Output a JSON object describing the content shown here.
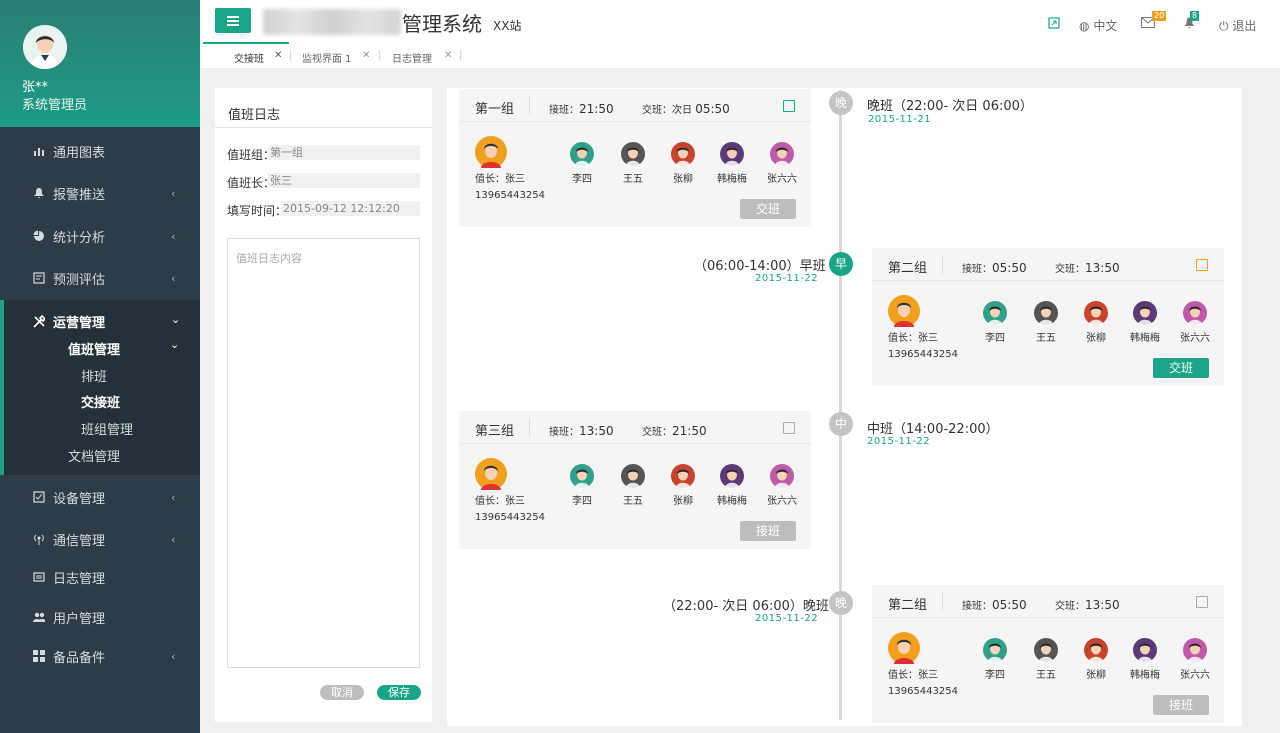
{
  "user": {
    "name": "张**",
    "role": "系统管理员"
  },
  "header": {
    "title": "管理系统",
    "subtitle": "XX站",
    "lang": "中文",
    "mail_count": "20",
    "bell_count": "8",
    "logout": "退出"
  },
  "tabs": [
    {
      "label": "交接班"
    },
    {
      "label": "监视界面 1"
    },
    {
      "label": "日志管理"
    }
  ],
  "sidebar": {
    "items": [
      {
        "label": "通用图表",
        "icon": "bar-chart-icon"
      },
      {
        "label": "报警推送",
        "icon": "bell-icon"
      },
      {
        "label": "统计分析",
        "icon": "pie-chart-icon"
      },
      {
        "label": "预测评估",
        "icon": "forecast-icon"
      },
      {
        "label": "运营管理",
        "icon": "tools-icon"
      },
      {
        "label": "设备管理",
        "icon": "device-icon"
      },
      {
        "label": "通信管理",
        "icon": "signal-icon"
      },
      {
        "label": "日志管理",
        "icon": "log-icon"
      },
      {
        "label": "用户管理",
        "icon": "users-icon"
      },
      {
        "label": "备品备件",
        "icon": "grid-icon"
      }
    ],
    "sub": {
      "duty": "值班管理",
      "schedule": "排班",
      "handover": "交接班",
      "groups": "班组管理",
      "docs": "文档管理"
    }
  },
  "log": {
    "title": "值班日志",
    "group_label": "值班组：",
    "group_value": "第一组",
    "leader_label": "值班长：",
    "leader_value": "张三",
    "time_label": "填写时间：",
    "time_value": "2015-09-12  12:12:20",
    "content_placeholder": "值班日志内容",
    "cancel": "取消",
    "save": "保存"
  },
  "timeline": [
    {
      "marker": "晚",
      "heading": "晚班（22:00- 次日 06:00）",
      "date": "2015-11-21"
    },
    {
      "marker": "早",
      "heading": "（06:00-14:00）早班",
      "date": "2015-11-22"
    },
    {
      "marker": "中",
      "heading": "中班（14:00-22:00）",
      "date": "2015-11-22"
    },
    {
      "marker": "晚",
      "heading": "（22:00- 次日 06:00）晚班",
      "date": "2015-11-22"
    }
  ],
  "cards": [
    {
      "group": "第一组",
      "on_label": "接班：",
      "on_time": "21:50",
      "off_label": "交班：次日 ",
      "off_time": "05:50",
      "button": "交班"
    },
    {
      "group": "第二组",
      "on_label": "接班：",
      "on_time": "05:50",
      "off_label": "交班：",
      "off_time": "13:50",
      "button": "交班"
    },
    {
      "group": "第三组",
      "on_label": "接班：",
      "on_time": "13:50",
      "off_label": "交班：",
      "off_time": "21:50",
      "button": "接班"
    },
    {
      "group": "第二组",
      "on_label": "接班：",
      "on_time": "05:50",
      "off_label": "交班：",
      "off_time": "13:50",
      "button": "接班"
    }
  ],
  "team": {
    "leader_label": "值长：张三",
    "leader_phone": "13965443254",
    "members": [
      "李四",
      "王五",
      "张柳",
      "韩梅梅",
      "张六六"
    ],
    "member_colors": [
      "#2fa08a",
      "#555555",
      "#c8432e",
      "#5b3a7a",
      "#c05aa8"
    ],
    "leader_color": "#f0a01e",
    "accent": "#1aa589"
  }
}
